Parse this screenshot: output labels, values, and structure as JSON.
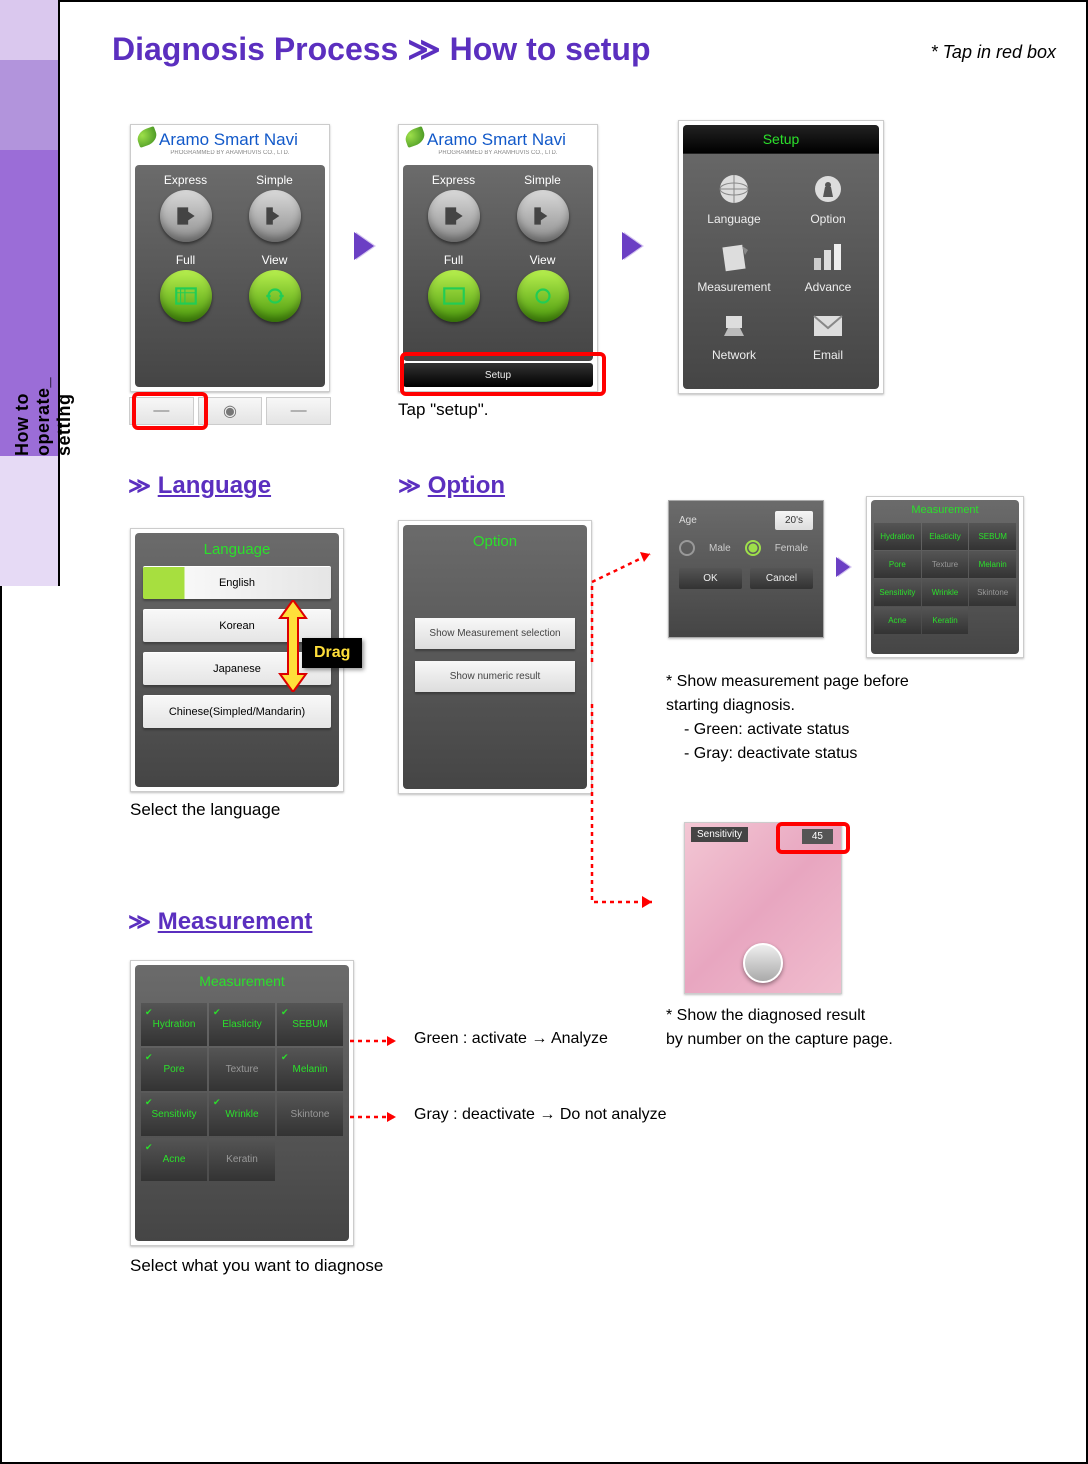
{
  "title_prefix": "Diagnosis Process",
  "title_sep": "≫",
  "title_suffix": "How to setup",
  "tap_hint": "* Tap in red box",
  "side_tab_label": "How to operate_ setting",
  "navi": {
    "brand": "Aramo Smart Navi",
    "sub": "PROGRAMMED BY ARAMHUVIS CO., LTD.",
    "buttons": [
      "Express",
      "Simple",
      "Full",
      "View"
    ],
    "bottom": "Setup"
  },
  "caption_tap_setup": "Tap \"setup\".",
  "setup_screen": {
    "title": "Setup",
    "items": [
      "Language",
      "Option",
      "Measurement",
      "Advance",
      "Network",
      "Email"
    ]
  },
  "sections": {
    "language_head": "Language",
    "option_head": "Option",
    "measurement_head": "Measurement"
  },
  "language_panel": {
    "title": "Language",
    "items": [
      "English",
      "Korean",
      "Japanese",
      "Chinese(Simpled/Mandarin)"
    ]
  },
  "drag_label": "Drag",
  "language_caption": "Select the language",
  "option_panel": {
    "title": "Option",
    "btn1": "Show Measurement selection",
    "btn2": "Show numeric result"
  },
  "age_gender": {
    "age_label": "Age",
    "age_value": "20's",
    "male": "Male",
    "female": "Female",
    "ok": "OK",
    "cancel": "Cancel"
  },
  "meas_small": {
    "title": "Measurement",
    "cells": [
      "Hydration",
      "Elasticity",
      "SEBUM",
      "Pore",
      "Texture",
      "Melanin",
      "Sensitivity",
      "Wrinkle",
      "Skintone",
      "Acne",
      "Keratin"
    ]
  },
  "opt_note1_l1": "* Show measurement page before",
  "opt_note1_l2": "starting diagnosis.",
  "opt_note1_b1": "- Green: activate status",
  "opt_note1_b2": "- Gray: deactivate status",
  "sens_photo": {
    "tag": "Sensitivity",
    "num": "45"
  },
  "opt_note2_l1": "* Show the diagnosed result",
  "opt_note2_l2": "by number on the capture page.",
  "meas_panel": {
    "title": "Measurement",
    "cells": [
      {
        "t": "Hydration",
        "on": true
      },
      {
        "t": "Elasticity",
        "on": true
      },
      {
        "t": "SEBUM",
        "on": true
      },
      {
        "t": "Pore",
        "on": true
      },
      {
        "t": "Texture",
        "on": false
      },
      {
        "t": "Melanin",
        "on": true
      },
      {
        "t": "Sensitivity",
        "on": true
      },
      {
        "t": "Wrinkle",
        "on": true
      },
      {
        "t": "Skintone",
        "on": false
      },
      {
        "t": "Acne",
        "on": true
      },
      {
        "t": "Keratin",
        "on": false
      }
    ]
  },
  "legend_green": "Green : activate → Analyze",
  "legend_gray": "Gray : deactivate → Do not analyze",
  "meas_caption": "Select what you want to diagnose",
  "chevron_small": "≫"
}
